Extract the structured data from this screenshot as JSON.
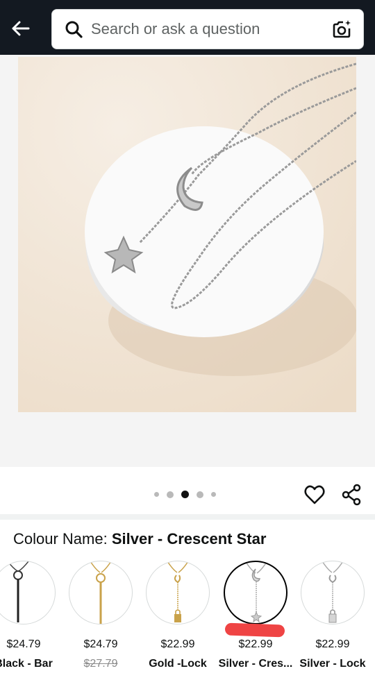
{
  "header": {
    "search_placeholder": "Search or ask a question",
    "back_icon": "arrow-left-icon",
    "search_icon": "magnifier-icon",
    "camera_icon": "camera-sparkle-icon",
    "background_color": "#131921"
  },
  "gallery": {
    "image_alt": "Silver crescent moon and star lariat necklace on white round pedestal",
    "dot_count": 5,
    "active_dot": 3
  },
  "actions": {
    "wishlist_icon": "heart-outline-icon",
    "share_icon": "share-icon"
  },
  "colour": {
    "label": "Colour Name:",
    "selected": "Silver - Crescent Star"
  },
  "swatches": [
    {
      "price": "$24.79",
      "name": "Black - Bar",
      "style": "black-bar"
    },
    {
      "price": "$24.79",
      "name": "$27.79",
      "style": "gold-bar",
      "strikethrough": true
    },
    {
      "price": "$22.99",
      "name": "Gold -Lock",
      "style": "gold-lock"
    },
    {
      "price": "$22.99",
      "name": "Silver - Cres...",
      "style": "silver-star",
      "selected": true
    },
    {
      "price": "$22.99",
      "name": "Silver - Lock",
      "style": "silver-lock"
    }
  ],
  "colors": {
    "accent_mark": "#ef4444",
    "selected_border": "#000000"
  }
}
